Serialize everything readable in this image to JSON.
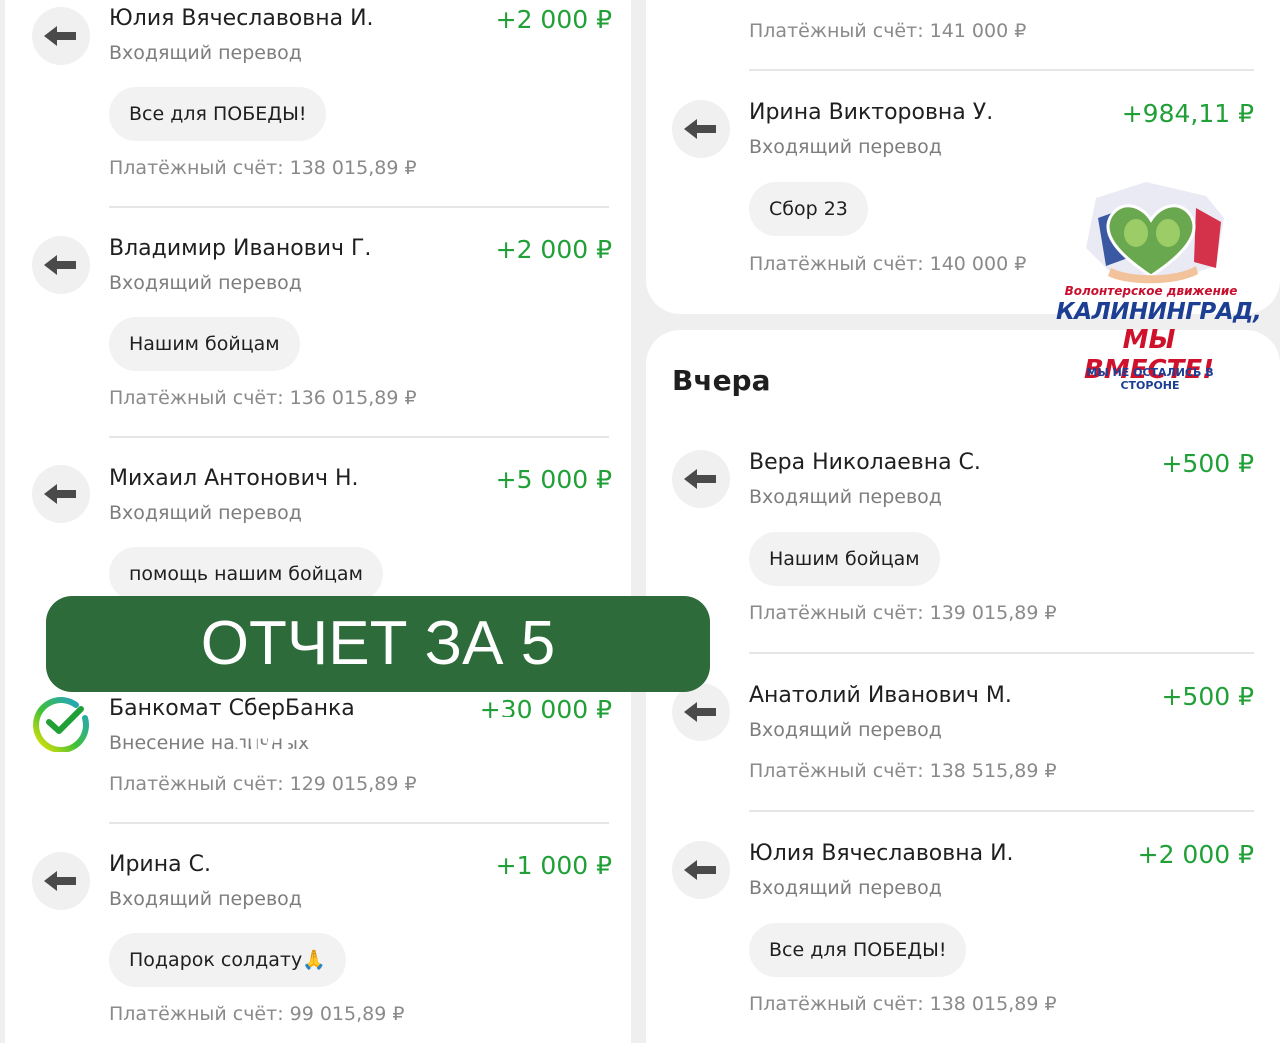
{
  "left_column": {
    "transactions": [
      {
        "name": "Юлия Вячеславовна И.",
        "amount": "+2 000 ₽",
        "type": "Входящий перевод",
        "message": "Все для ПОБЕДЫ!",
        "balance": "Платёжный счёт: 138 015,89 ₽",
        "icon": "arrow-left-icon"
      },
      {
        "name": "Владимир Иванович Г.",
        "amount": "+2 000 ₽",
        "type": "Входящий перевод",
        "message": "Нашим бойцам",
        "balance": "Платёжный счёт: 136 015,89 ₽",
        "icon": "arrow-left-icon"
      },
      {
        "name": "Михаил Антонович Н.",
        "amount": "+5 000 ₽",
        "type": "Входящий перевод",
        "message": "помощь нашим бойцам",
        "icon": "arrow-left-icon"
      },
      {
        "name": "Банкомат СберБанка",
        "amount": "+30 000 ₽",
        "type": "Внесение наличных",
        "balance": "Платёжный счёт: 129 015,89 ₽",
        "icon": "sberbank-logo-icon"
      },
      {
        "name": "Ирина С.",
        "amount": "+1 000 ₽",
        "type": "Входящий перевод",
        "message": "Подарок солдату🙏",
        "balance": "Платёжный счёт: 99 015,89 ₽",
        "icon": "arrow-left-icon"
      }
    ]
  },
  "right_column": {
    "top_balance": "Платёжный счёт: 141 000 ₽",
    "top_transaction": {
      "name": "Ирина Викторовна У.",
      "amount": "+984,11 ₽",
      "type": "Входящий перевод",
      "message": "Сбор 23",
      "balance": "Платёжный счёт: 140 000 ₽",
      "icon": "arrow-left-icon"
    },
    "section_title": "Вчера",
    "transactions": [
      {
        "name": "Вера Николаевна С.",
        "amount": "+500 ₽",
        "type": "Входящий перевод",
        "message": "Нашим бойцам",
        "balance": "Платёжный счёт: 139 015,89 ₽",
        "icon": "arrow-left-icon"
      },
      {
        "name": "Анатолий Иванович М.",
        "amount": "+500 ₽",
        "type": "Входящий перевод",
        "balance": "Платёжный счёт: 138 515,89 ₽",
        "icon": "arrow-left-icon"
      },
      {
        "name": "Юлия Вячеславовна И.",
        "amount": "+2 000 ₽",
        "type": "Входящий перевод",
        "message": "Все для ПОБЕДЫ!",
        "balance": "Платёжный счёт: 138 015,89 ₽",
        "icon": "arrow-left-icon"
      }
    ]
  },
  "banner": {
    "text": "ОТЧЕТ ЗА 5 ФЕВРАЛЯ",
    "color": "#2e6b3a"
  },
  "logo": {
    "line1": "Волонтерское движение",
    "line2": "КАЛИНИНГРАД,",
    "line3": "МЫ ВМЕСТЕ!",
    "line4": "МЫ НЕ ОСТАЛИСЬ В СТОРОНЕ"
  },
  "colors": {
    "amount": "#21a038",
    "secondary_text": "#7d7d7d",
    "chip_bg": "#f2f2f2"
  }
}
